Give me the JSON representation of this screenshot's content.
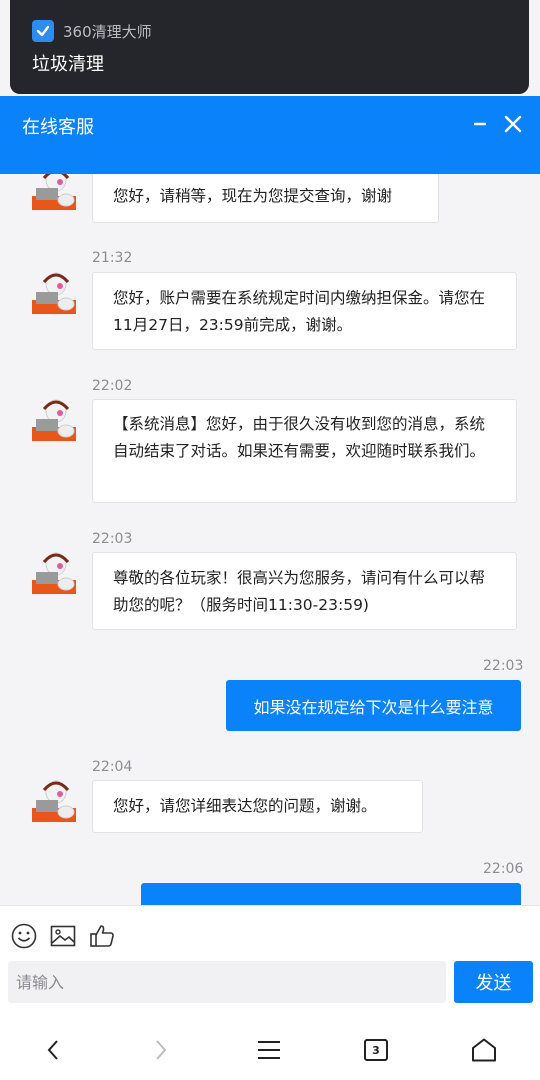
{
  "notification": {
    "app_name": "360清理大师",
    "title": "垃圾清理"
  },
  "header": {
    "title": "在线客服"
  },
  "messages": [
    {
      "text": "您好，请稍等，现在为您提交查询，谢谢"
    },
    {
      "time": "21:32",
      "text": "您好，账户需要在系统规定时间内缴纳担保金。请您在11月27日，23:59前完成，谢谢。"
    },
    {
      "time": "22:02",
      "text": "【系统消息】您好，由于很久没有收到您的消息，系统自动结束了对话。如果还有需要，欢迎随时联系我们。"
    },
    {
      "time": "22:03",
      "text": "尊敬的各位玩家！很高兴为您服务，请问有什么可以帮助您的呢？（服务时间11:30-23:59)"
    },
    {
      "time": "22:03",
      "text": "如果没在规定给下次是什么要注意"
    },
    {
      "time": "22:04",
      "text": "您好，请您详细表达您的问题，谢谢。"
    },
    {
      "time": "22:06"
    }
  ],
  "input": {
    "placeholder": "请输入",
    "value": ""
  },
  "send_label": "发送",
  "nav": {
    "tab_count": "3"
  },
  "colors": {
    "accent": "#0a83fa",
    "notification_bg": "#24262b"
  }
}
